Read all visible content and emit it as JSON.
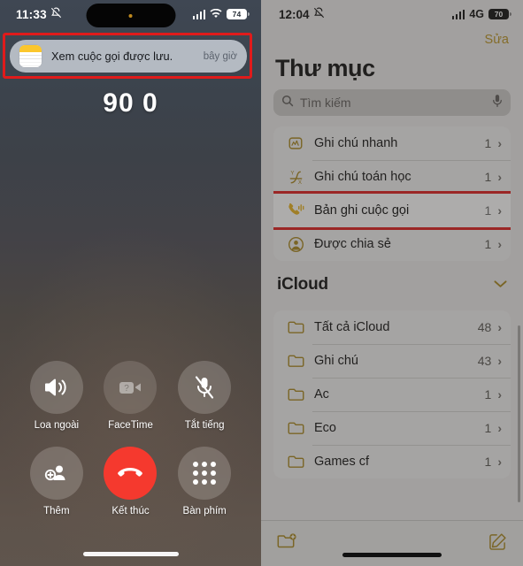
{
  "left_phone": {
    "status_bar": {
      "time": "11:33",
      "silent_icon": "bell-slash-icon",
      "signal_icon": "cellular-bars-icon",
      "wifi_icon": "wifi-icon",
      "battery_level": "74"
    },
    "notification": {
      "app_icon": "notes-app-icon",
      "message": "Xem cuộc gọi được lưu.",
      "time": "bây giờ",
      "highlighted": true,
      "highlight_color": "#e01b1b"
    },
    "call": {
      "number": "90 0",
      "controls": [
        {
          "label": "Loa ngoài",
          "icon": "speaker-wave-icon",
          "style": "normal"
        },
        {
          "label": "FaceTime",
          "icon": "video-camera-icon",
          "style": "disabled"
        },
        {
          "label": "Tắt tiếng",
          "icon": "microphone-slash-icon",
          "style": "normal"
        },
        {
          "label": "Thêm",
          "icon": "add-person-icon",
          "style": "normal"
        },
        {
          "label": "Kết thúc",
          "icon": "phone-down-icon",
          "style": "end"
        },
        {
          "label": "Bàn phím",
          "icon": "keypad-dots-icon",
          "style": "normal"
        }
      ]
    }
  },
  "right_phone": {
    "status_bar": {
      "time": "12:04",
      "silent_icon": "bell-slash-icon",
      "signal_icon": "cellular-bars-icon",
      "network": "4G",
      "battery_level": "70"
    },
    "edit_button": "Sửa",
    "title": "Thư mục",
    "search": {
      "placeholder": "Tìm kiếm",
      "icon": "search-icon",
      "mic_icon": "microphone-icon"
    },
    "smart_folders": [
      {
        "label": "Ghi chú nhanh",
        "count": "1",
        "icon": "quick-note-icon",
        "highlighted": false
      },
      {
        "label": "Ghi chú toán học",
        "count": "1",
        "icon": "math-notes-icon",
        "highlighted": false
      },
      {
        "label": "Bản ghi cuộc gọi",
        "count": "1",
        "icon": "call-recording-icon",
        "highlighted": true
      },
      {
        "label": "Được chia sẻ",
        "count": "1",
        "icon": "shared-person-icon",
        "highlighted": false
      }
    ],
    "icloud_section": {
      "title": "iCloud",
      "collapse_icon": "chevron-down-icon",
      "folders": [
        {
          "label": "Tất cả iCloud",
          "count": "48",
          "icon": "folder-icon"
        },
        {
          "label": "Ghi chú",
          "count": "43",
          "icon": "folder-icon"
        },
        {
          "label": "Ac",
          "count": "1",
          "icon": "folder-icon"
        },
        {
          "label": "Eco",
          "count": "1",
          "icon": "folder-icon"
        },
        {
          "label": "Games cf",
          "count": "1",
          "icon": "folder-icon"
        }
      ]
    },
    "toolbar": {
      "new_folder_icon": "new-folder-icon",
      "compose_icon": "compose-note-icon"
    },
    "accent_color": "#b9921f",
    "highlight_color": "#e01b1b"
  }
}
